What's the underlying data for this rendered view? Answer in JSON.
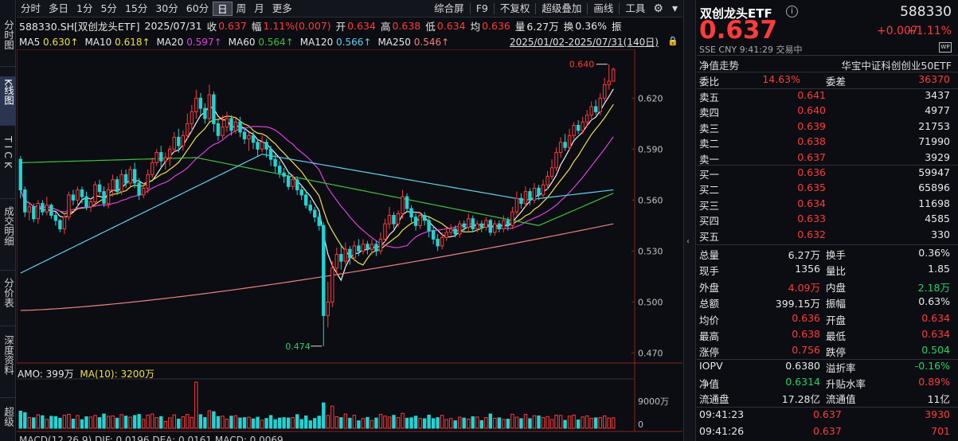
{
  "leftbar": {
    "items": [
      {
        "label": "分时图"
      },
      {
        "label": "K线图"
      },
      {
        "label": "TICK"
      },
      {
        "label": "成交明细"
      },
      {
        "label": "分价表"
      },
      {
        "label": "深度资料"
      },
      {
        "label": "超级"
      }
    ]
  },
  "toolbar": {
    "periods": [
      "分时",
      "多日",
      "1分",
      "5分",
      "15分",
      "30分",
      "60分",
      "日",
      "周",
      "月",
      "更多"
    ],
    "selected": "日",
    "tools": [
      "综合屏",
      "F9",
      "不复权",
      "超级叠加",
      "画线",
      "工具"
    ]
  },
  "info": {
    "code": "588330.SH[双创龙头ETF]",
    "date": "2025/07/31",
    "close_label": "收",
    "close": "0.637",
    "amp_label": "幅",
    "amp": "1.11%(0.007)",
    "open_label": "开",
    "open": "0.634",
    "high_label": "高",
    "high": "0.638",
    "low_label": "低",
    "low": "0.634",
    "avg_label": "均",
    "avg": "0.636",
    "vol_label": "量",
    "vol": "6.27万",
    "turn_label": "换",
    "turn": "0.36%",
    "tail": "振"
  },
  "ma": {
    "ma5_label": "MA5",
    "ma5": "0.630↑",
    "ma10_label": "MA10",
    "ma10": "0.618↑",
    "ma20_label": "MA20",
    "ma20": "0.597↑",
    "ma60_label": "MA60",
    "ma60": "0.564↑",
    "ma120_label": "MA120",
    "ma120": "0.566↑",
    "ma250_label": "MA250",
    "ma250": "0.546↑",
    "colors": {
      "ma5": "#f0f0f0",
      "ma10": "#f0e040",
      "ma20": "#e040e0",
      "ma60": "#40c040",
      "ma120": "#60d0f0",
      "ma250": "#f08080"
    }
  },
  "date_range": "2025/01/02-2025/07/31(140日)",
  "amo": {
    "label": "AMO:",
    "value": "399万",
    "ma_label": "MA(10):",
    "ma_value": "3200万"
  },
  "macd": {
    "text": "MACD(12,26,9)  DIF: 0.0196  DEA: 0.0161  MACD: 0.0069"
  },
  "chart_data": {
    "type": "candlestick",
    "ylim": [
      0.465,
      0.645
    ],
    "yticks": [
      "0.620",
      "0.590",
      "0.560",
      "0.530",
      "0.500",
      "0.470"
    ],
    "ytick_values": [
      0.62,
      0.59,
      0.56,
      0.53,
      0.5,
      0.47
    ],
    "high_label": "0.640",
    "low_label": "0.474",
    "vol_ticks": [
      "9000万",
      "0"
    ],
    "vol_tick_values": [
      90000000,
      0
    ],
    "up_color": "#ff3b3b",
    "down_color": "#23d3d3",
    "candles": [
      [
        0.584,
        0.566,
        0.586,
        0.561
      ],
      [
        0.566,
        0.553,
        0.568,
        0.55
      ],
      [
        0.553,
        0.556,
        0.559,
        0.548
      ],
      [
        0.556,
        0.549,
        0.558,
        0.547
      ],
      [
        0.549,
        0.558,
        0.56,
        0.546
      ],
      [
        0.558,
        0.553,
        0.56,
        0.551
      ],
      [
        0.553,
        0.557,
        0.562,
        0.551
      ],
      [
        0.557,
        0.551,
        0.558,
        0.549
      ],
      [
        0.551,
        0.548,
        0.553,
        0.545
      ],
      [
        0.548,
        0.543,
        0.549,
        0.541
      ],
      [
        0.543,
        0.55,
        0.552,
        0.54
      ],
      [
        0.55,
        0.563,
        0.565,
        0.548
      ],
      [
        0.563,
        0.56,
        0.566,
        0.557
      ],
      [
        0.56,
        0.566,
        0.568,
        0.556
      ],
      [
        0.566,
        0.562,
        0.568,
        0.558
      ],
      [
        0.562,
        0.556,
        0.565,
        0.554
      ],
      [
        0.556,
        0.559,
        0.561,
        0.553
      ],
      [
        0.559,
        0.569,
        0.571,
        0.556
      ],
      [
        0.569,
        0.565,
        0.572,
        0.563
      ],
      [
        0.565,
        0.558,
        0.568,
        0.556
      ],
      [
        0.558,
        0.566,
        0.57,
        0.555
      ],
      [
        0.566,
        0.572,
        0.575,
        0.562
      ],
      [
        0.572,
        0.565,
        0.574,
        0.563
      ],
      [
        0.565,
        0.575,
        0.578,
        0.563
      ],
      [
        0.575,
        0.57,
        0.578,
        0.567
      ],
      [
        0.57,
        0.578,
        0.58,
        0.568
      ],
      [
        0.578,
        0.57,
        0.582,
        0.567
      ],
      [
        0.57,
        0.563,
        0.573,
        0.56
      ],
      [
        0.563,
        0.567,
        0.57,
        0.561
      ],
      [
        0.567,
        0.575,
        0.578,
        0.564
      ],
      [
        0.575,
        0.582,
        0.585,
        0.573
      ],
      [
        0.582,
        0.588,
        0.59,
        0.58
      ],
      [
        0.588,
        0.583,
        0.592,
        0.579
      ],
      [
        0.583,
        0.585,
        0.588,
        0.578
      ],
      [
        0.585,
        0.59,
        0.592,
        0.58
      ],
      [
        0.59,
        0.597,
        0.6,
        0.588
      ],
      [
        0.597,
        0.592,
        0.602,
        0.588
      ],
      [
        0.592,
        0.598,
        0.601,
        0.589
      ],
      [
        0.598,
        0.605,
        0.611,
        0.596
      ],
      [
        0.605,
        0.612,
        0.616,
        0.6
      ],
      [
        0.612,
        0.62,
        0.625,
        0.608
      ],
      [
        0.62,
        0.614,
        0.623,
        0.61
      ],
      [
        0.614,
        0.608,
        0.617,
        0.605
      ],
      [
        0.608,
        0.622,
        0.628,
        0.606
      ],
      [
        0.622,
        0.605,
        0.624,
        0.6
      ],
      [
        0.605,
        0.598,
        0.608,
        0.595
      ],
      [
        0.598,
        0.603,
        0.61,
        0.596
      ],
      [
        0.603,
        0.608,
        0.612,
        0.6
      ],
      [
        0.608,
        0.601,
        0.61,
        0.598
      ],
      [
        0.601,
        0.606,
        0.608,
        0.599
      ],
      [
        0.606,
        0.6,
        0.609,
        0.597
      ],
      [
        0.6,
        0.596,
        0.603,
        0.593
      ],
      [
        0.596,
        0.598,
        0.6,
        0.589
      ],
      [
        0.598,
        0.594,
        0.6,
        0.59
      ],
      [
        0.594,
        0.59,
        0.596,
        0.586
      ],
      [
        0.59,
        0.594,
        0.598,
        0.588
      ],
      [
        0.594,
        0.59,
        0.596,
        0.585
      ],
      [
        0.59,
        0.584,
        0.592,
        0.58
      ],
      [
        0.584,
        0.58,
        0.587,
        0.576
      ],
      [
        0.58,
        0.576,
        0.583,
        0.573
      ],
      [
        0.576,
        0.574,
        0.579,
        0.57
      ],
      [
        0.574,
        0.568,
        0.577,
        0.566
      ],
      [
        0.568,
        0.572,
        0.575,
        0.566
      ],
      [
        0.572,
        0.566,
        0.574,
        0.563
      ],
      [
        0.566,
        0.563,
        0.569,
        0.56
      ],
      [
        0.563,
        0.557,
        0.566,
        0.555
      ],
      [
        0.557,
        0.554,
        0.56,
        0.552
      ],
      [
        0.554,
        0.55,
        0.556,
        0.547
      ],
      [
        0.55,
        0.545,
        0.552,
        0.542
      ],
      [
        0.545,
        0.492,
        0.547,
        0.474
      ],
      [
        0.492,
        0.5,
        0.512,
        0.485
      ],
      [
        0.5,
        0.52,
        0.524,
        0.497
      ],
      [
        0.52,
        0.528,
        0.532,
        0.516
      ],
      [
        0.528,
        0.524,
        0.534,
        0.519
      ],
      [
        0.524,
        0.531,
        0.535,
        0.522
      ],
      [
        0.531,
        0.526,
        0.533,
        0.522
      ],
      [
        0.526,
        0.533,
        0.536,
        0.524
      ],
      [
        0.533,
        0.53,
        0.537,
        0.527
      ],
      [
        0.53,
        0.534,
        0.537,
        0.528
      ],
      [
        0.534,
        0.531,
        0.536,
        0.528
      ],
      [
        0.531,
        0.534,
        0.537,
        0.528
      ],
      [
        0.534,
        0.53,
        0.536,
        0.527
      ],
      [
        0.53,
        0.537,
        0.541,
        0.528
      ],
      [
        0.537,
        0.546,
        0.549,
        0.535
      ],
      [
        0.546,
        0.551,
        0.556,
        0.543
      ],
      [
        0.551,
        0.546,
        0.553,
        0.543
      ],
      [
        0.546,
        0.552,
        0.554,
        0.544
      ],
      [
        0.552,
        0.562,
        0.566,
        0.549
      ],
      [
        0.562,
        0.555,
        0.564,
        0.553
      ],
      [
        0.555,
        0.55,
        0.557,
        0.547
      ],
      [
        0.55,
        0.545,
        0.552,
        0.542
      ],
      [
        0.545,
        0.551,
        0.553,
        0.543
      ],
      [
        0.551,
        0.548,
        0.553,
        0.545
      ],
      [
        0.548,
        0.542,
        0.55,
        0.538
      ],
      [
        0.542,
        0.537,
        0.545,
        0.534
      ],
      [
        0.537,
        0.533,
        0.54,
        0.53
      ],
      [
        0.533,
        0.538,
        0.541,
        0.531
      ],
      [
        0.538,
        0.541,
        0.543,
        0.536
      ],
      [
        0.541,
        0.543,
        0.546,
        0.539
      ],
      [
        0.543,
        0.54,
        0.545,
        0.538
      ],
      [
        0.54,
        0.546,
        0.548,
        0.538
      ],
      [
        0.546,
        0.544,
        0.548,
        0.541
      ],
      [
        0.544,
        0.549,
        0.552,
        0.542
      ],
      [
        0.549,
        0.543,
        0.551,
        0.541
      ],
      [
        0.543,
        0.546,
        0.548,
        0.541
      ],
      [
        0.546,
        0.544,
        0.548,
        0.541
      ],
      [
        0.544,
        0.548,
        0.55,
        0.542
      ],
      [
        0.548,
        0.541,
        0.549,
        0.539
      ],
      [
        0.541,
        0.546,
        0.548,
        0.539
      ],
      [
        0.546,
        0.543,
        0.548,
        0.541
      ],
      [
        0.543,
        0.548,
        0.551,
        0.541
      ],
      [
        0.548,
        0.545,
        0.55,
        0.542
      ],
      [
        0.545,
        0.553,
        0.556,
        0.543
      ],
      [
        0.553,
        0.561,
        0.565,
        0.551
      ],
      [
        0.561,
        0.558,
        0.564,
        0.555
      ],
      [
        0.558,
        0.565,
        0.568,
        0.556
      ],
      [
        0.565,
        0.56,
        0.567,
        0.557
      ],
      [
        0.56,
        0.567,
        0.57,
        0.558
      ],
      [
        0.567,
        0.563,
        0.569,
        0.56
      ],
      [
        0.563,
        0.569,
        0.572,
        0.561
      ],
      [
        0.569,
        0.574,
        0.577,
        0.566
      ],
      [
        0.574,
        0.579,
        0.584,
        0.572
      ],
      [
        0.579,
        0.588,
        0.591,
        0.577
      ],
      [
        0.588,
        0.594,
        0.597,
        0.585
      ],
      [
        0.594,
        0.591,
        0.599,
        0.589
      ],
      [
        0.591,
        0.598,
        0.602,
        0.589
      ],
      [
        0.598,
        0.604,
        0.606,
        0.596
      ],
      [
        0.604,
        0.601,
        0.607,
        0.599
      ],
      [
        0.601,
        0.606,
        0.609,
        0.599
      ],
      [
        0.606,
        0.61,
        0.613,
        0.603
      ],
      [
        0.61,
        0.615,
        0.618,
        0.607
      ],
      [
        0.615,
        0.612,
        0.619,
        0.61
      ],
      [
        0.612,
        0.62,
        0.623,
        0.61
      ],
      [
        0.62,
        0.628,
        0.632,
        0.618
      ],
      [
        0.628,
        0.63,
        0.64,
        0.625
      ],
      [
        0.63,
        0.637,
        0.638,
        0.634
      ]
    ]
  },
  "right": {
    "name": "双创龙头ETF",
    "code": "588330",
    "price": "0.637",
    "change": "+0.007",
    "change_pct": "+1.11%",
    "meta": {
      "ex": "SSE",
      "cur": "CNY",
      "time": "9:41:29",
      "status": "交易中"
    },
    "sub_left": "净值走势",
    "sub_right": "华宝中证科创创业50ETF",
    "weibi_label": "委比",
    "weibi": "14.63%",
    "weicha_label": "委差",
    "weicha": "36370",
    "sells": [
      {
        "label": "卖五",
        "price": "0.641",
        "vol": "3437"
      },
      {
        "label": "卖四",
        "price": "0.640",
        "vol": "4977"
      },
      {
        "label": "卖三",
        "price": "0.639",
        "vol": "21753"
      },
      {
        "label": "卖二",
        "price": "0.638",
        "vol": "71990"
      },
      {
        "label": "卖一",
        "price": "0.637",
        "vol": "3929"
      }
    ],
    "buys": [
      {
        "label": "买一",
        "price": "0.636",
        "vol": "59947"
      },
      {
        "label": "买二",
        "price": "0.635",
        "vol": "65896"
      },
      {
        "label": "买三",
        "price": "0.634",
        "vol": "11698"
      },
      {
        "label": "买四",
        "price": "0.633",
        "vol": "4585"
      },
      {
        "label": "买五",
        "price": "0.632",
        "vol": "330"
      }
    ],
    "stats": [
      {
        "l1": "总量",
        "v1": "6.27万",
        "c1": "white",
        "l2": "换手",
        "v2": "0.36%",
        "c2": "white"
      },
      {
        "l1": "现手",
        "v1": "1356",
        "c1": "white",
        "l2": "量比",
        "v2": "1.85",
        "c2": "white"
      },
      {
        "l1": "外盘",
        "v1": "4.09万",
        "c1": "red",
        "l2": "内盘",
        "v2": "2.18万",
        "c2": "green"
      },
      {
        "l1": "总额",
        "v1": "399.15万",
        "c1": "white",
        "l2": "振幅",
        "v2": "0.63%",
        "c2": "white"
      },
      {
        "l1": "均价",
        "v1": "0.636",
        "c1": "red",
        "l2": "开盘",
        "v2": "0.634",
        "c2": "red"
      },
      {
        "l1": "最高",
        "v1": "0.638",
        "c1": "red",
        "l2": "最低",
        "v2": "0.634",
        "c2": "red"
      },
      {
        "l1": "涨停",
        "v1": "0.756",
        "c1": "red",
        "l2": "跌停",
        "v2": "0.504",
        "c2": "green"
      }
    ],
    "stats2": [
      {
        "l1": "IOPV",
        "v1": "0.6380",
        "c1": "white",
        "l2": "溢折率",
        "v2": "-0.16%",
        "c2": "green"
      },
      {
        "l1": "净值",
        "v1": "0.6314",
        "c1": "green",
        "l2": "升贴水率",
        "v2": "0.89%",
        "c2": "red"
      },
      {
        "l1": "流通盘",
        "v1": "17.28亿",
        "c1": "white",
        "l2": "流通值",
        "v2": "11亿",
        "c2": "white"
      }
    ],
    "ticks": [
      {
        "time": "09:41:23",
        "price": "0.637",
        "vol": "3930"
      },
      {
        "time": "09:41:26",
        "price": "0.637",
        "vol": "701"
      }
    ]
  }
}
